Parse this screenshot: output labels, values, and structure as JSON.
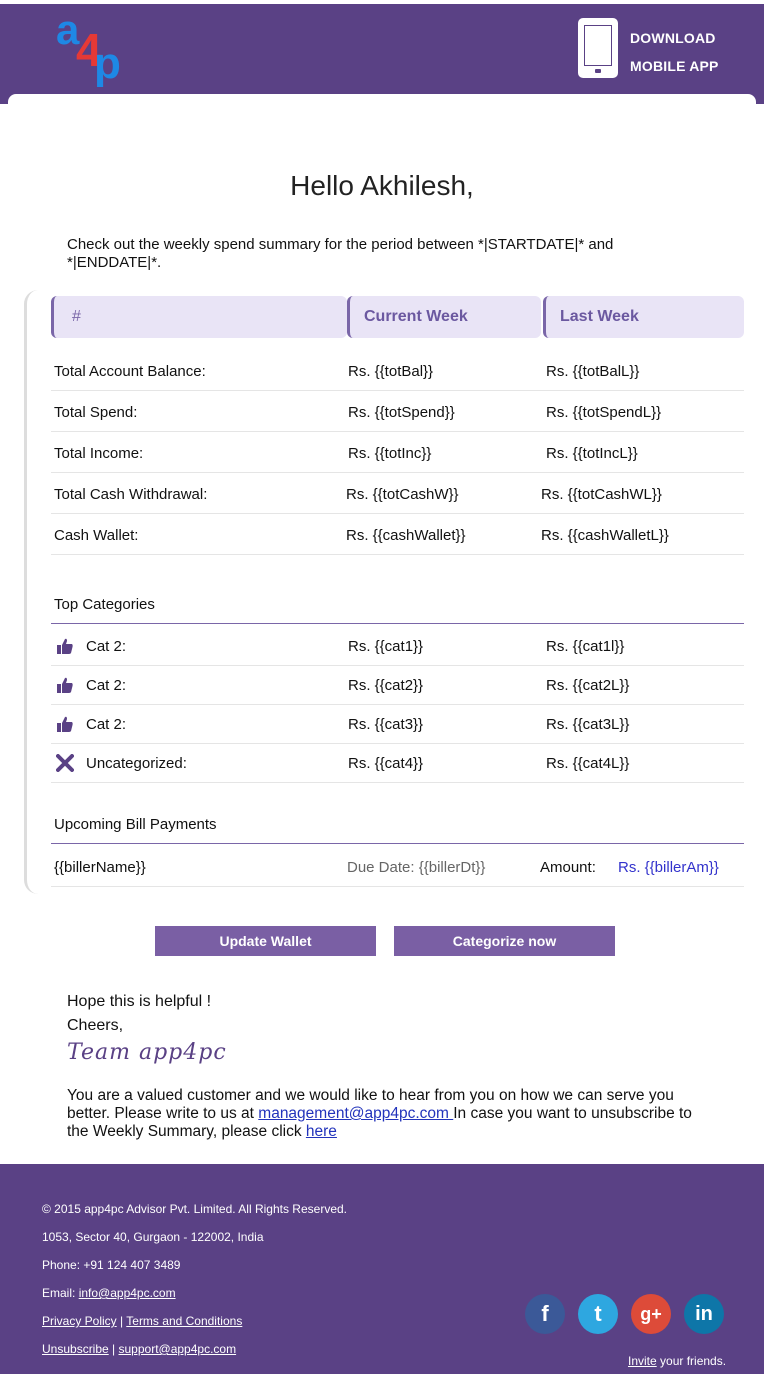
{
  "header": {
    "download_line1": "DOWNLOAD",
    "download_line2": "MOBILE APP"
  },
  "greeting": "Hello Akhilesh,",
  "intro": "Check out the weekly spend summary for the period between *|STARTDATE|* and *|ENDDATE|*.",
  "table": {
    "headers": [
      "#",
      "Current Week",
      "Last Week"
    ],
    "rows": [
      {
        "label": "Total Account Balance:",
        "current": "Rs. {{totBal}}",
        "last": "Rs. {{totBalL}}"
      },
      {
        "label": "Total Spend:",
        "current": "Rs. {{totSpend}}",
        "last": "Rs. {{totSpendL}}"
      },
      {
        "label": "Total Income:",
        "current": "Rs. {{totInc}}",
        "last": "Rs. {{totIncL}}"
      },
      {
        "label": "Total Cash Withdrawal:",
        "current": "Rs. {{totCashW}}",
        "last": "Rs. {{totCashWL}}"
      },
      {
        "label": "Cash Wallet:",
        "current": "Rs. {{cashWallet}}",
        "last": "Rs. {{cashWalletL}}"
      }
    ]
  },
  "categories": {
    "title": "Top Categories",
    "items": [
      {
        "icon": "thumbs-up-icon",
        "label": "Cat 2:",
        "current": "Rs. {{cat1}}",
        "last": "Rs. {{cat1l}}"
      },
      {
        "icon": "thumbs-up-icon",
        "label": "Cat 2:",
        "current": "Rs. {{cat2}}",
        "last": "Rs. {{cat2L}}"
      },
      {
        "icon": "thumbs-up-icon",
        "label": "Cat 2:",
        "current": "Rs. {{cat3}}",
        "last": "Rs. {{cat3L}}"
      },
      {
        "icon": "cross-icon",
        "label": "Uncategorized:",
        "current": "Rs. {{cat4}}",
        "last": "Rs. {{cat4L}}"
      }
    ]
  },
  "bills": {
    "title": "Upcoming Bill Payments",
    "biller": "{{billerName}}",
    "due": "Due Date: {{billerDt}}",
    "amount_label": "Amount:",
    "amount": "Rs. {{billerAm}}"
  },
  "buttons": {
    "update_wallet": "Update Wallet",
    "categorize_now": "Categorize now"
  },
  "closing": {
    "line1": "Hope this is helpful !",
    "line2": "Cheers,",
    "signature": "Team app4pc",
    "note_before": "You are a valued customer and we would like to hear from you on how we can serve you better. Please write to us at ",
    "note_email": "management@app4pc.com ",
    "note_middle": "In case you want to unsubscribe to the Weekly Summary, please click ",
    "note_link": "here"
  },
  "footer": {
    "copyright": "© 2015 app4pc Advisor Pvt. Limited. All Rights Reserved.",
    "address": "1053, Sector 40, Gurgaon - 122002, India",
    "phone": "Phone: +91 124 407 3489",
    "email_label": "Email: ",
    "email": "info@app4pc.com",
    "privacy": "Privacy Policy",
    "sep": " | ",
    "terms": "Terms and Conditions",
    "unsubscribe": "Unsubscribe",
    "support": "support@app4pc.com",
    "invite_link": "Invite",
    "invite_rest": " your friends."
  },
  "social": {
    "facebook": "f",
    "twitter": "t",
    "googleplus": "g+",
    "linkedin": "in"
  },
  "colors": {
    "brand_purple": "#5a4185",
    "button_purple": "#7a5fa4",
    "header_cell": "#e9e4f6",
    "link_blue": "#3333cc"
  }
}
